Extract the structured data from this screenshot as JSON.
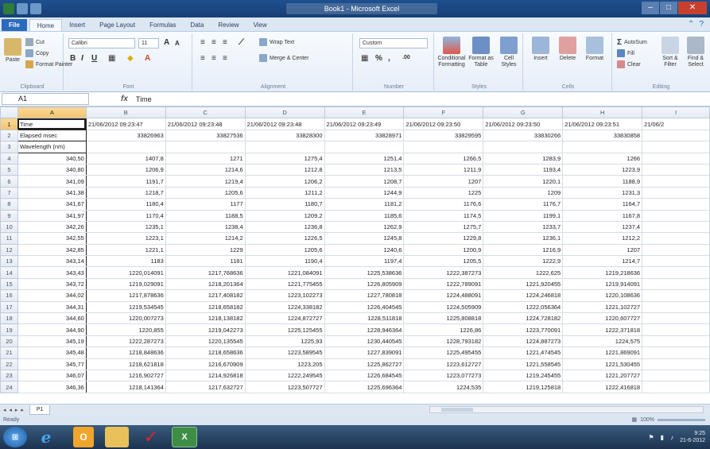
{
  "window": {
    "title": "Book1 - Microsoft Excel"
  },
  "ribbon_tabs": [
    "File",
    "Home",
    "Insert",
    "Page Layout",
    "Formulas",
    "Data",
    "Review",
    "View"
  ],
  "ribbon": {
    "clipboard": {
      "paste": "Paste",
      "cut": "Cut",
      "copy": "Copy",
      "format_painter": "Format Painter",
      "label": "Clipboard"
    },
    "font": {
      "name": "Calibri",
      "size": "11",
      "label": "Font"
    },
    "alignment": {
      "wrap": "Wrap Text",
      "merge": "Merge & Center",
      "label": "Alignment"
    },
    "number": {
      "format": "Custom",
      "label": "Number"
    },
    "styles": {
      "conditional": "Conditional Formatting",
      "format_table": "Format as Table",
      "cell_styles": "Cell Styles",
      "label": "Styles"
    },
    "cells": {
      "insert": "Insert",
      "delete": "Delete",
      "format": "Format",
      "label": "Cells"
    },
    "editing": {
      "autosum": "AutoSum",
      "fill": "Fill",
      "clear": "Clear",
      "sort": "Sort & Filter",
      "find": "Find & Select",
      "label": "Editing"
    }
  },
  "formula_bar": {
    "name_box": "A1",
    "fx": "fx",
    "formula": "Time"
  },
  "columns": [
    "A",
    "B",
    "C",
    "D",
    "E",
    "F",
    "G",
    "H",
    "I"
  ],
  "rows": [
    [
      "Time",
      "21/06/2012 09:23:47",
      "21/06/2012 09:23:48",
      "21/06/2012 09:23:48",
      "21/06/2012 09:23:49",
      "21/06/2012 09:23:50",
      "21/06/2012 09:23:50",
      "21/06/2012 09:23:51",
      "21/06/2"
    ],
    [
      "Elapsed msec",
      "33826963",
      "33827536",
      "33828300",
      "33828971",
      "33829595",
      "33830266",
      "33830858",
      ""
    ],
    [
      "Wavelength (nm)",
      "",
      "",
      "",
      "",
      "",
      "",
      "",
      ""
    ],
    [
      "340,50",
      "1407,8",
      "1271",
      "1275,4",
      "1251,4",
      "1266,5",
      "1283,9",
      "1266",
      ""
    ],
    [
      "340,80",
      "1206,9",
      "1214,6",
      "1212,8",
      "1213,5",
      "1211,9",
      "1193,4",
      "1223,9",
      ""
    ],
    [
      "341,09",
      "1191,7",
      "1219,4",
      "1206,2",
      "1208,7",
      "1207",
      "1220,1",
      "1188,9",
      ""
    ],
    [
      "341,38",
      "1218,7",
      "1205,6",
      "1211,2",
      "1244,9",
      "1225",
      "1209",
      "1231,3",
      ""
    ],
    [
      "341,67",
      "1180,4",
      "1177",
      "1180,7",
      "1181,2",
      "1176,6",
      "1176,7",
      "1164,7",
      ""
    ],
    [
      "341,97",
      "1170,4",
      "1188,5",
      "1209,2",
      "1185,6",
      "1174,5",
      "1199,1",
      "1167,8",
      ""
    ],
    [
      "342,26",
      "1235,1",
      "1238,4",
      "1236,8",
      "1262,9",
      "1275,7",
      "1233,7",
      "1237,4",
      ""
    ],
    [
      "342,55",
      "1223,1",
      "1214,2",
      "1226,5",
      "1245,8",
      "1229,8",
      "1236,1",
      "1212,2",
      ""
    ],
    [
      "342,85",
      "1221,1",
      "1229",
      "1205,6",
      "1240,6",
      "1200,9",
      "1216,9",
      "1207",
      ""
    ],
    [
      "343,14",
      "1183",
      "1181",
      "1190,4",
      "1197,4",
      "1205,5",
      "1222,9",
      "1214,7",
      ""
    ],
    [
      "343,43",
      "1220,014091",
      "1217,768636",
      "1221,084091",
      "1225,538636",
      "1222,387273",
      "1222,625",
      "1219,218636",
      ""
    ],
    [
      "343,72",
      "1219,029091",
      "1218,201364",
      "1221,775455",
      "1226,805909",
      "1222,789091",
      "1221,920455",
      "1219,914091",
      ""
    ],
    [
      "344,02",
      "1217,878636",
      "1217,408182",
      "1223,102273",
      "1227,780818",
      "1224,488091",
      "1224,246818",
      "1220,108636",
      ""
    ],
    [
      "344,31",
      "1219,534545",
      "1218,658182",
      "1224,338182",
      "1226,404545",
      "1224,505909",
      "1222,056364",
      "1221,102727",
      ""
    ],
    [
      "344,60",
      "1220,007273",
      "1218,138182",
      "1224,872727",
      "1228,511818",
      "1225,808818",
      "1224,728182",
      "1220,607727",
      ""
    ],
    [
      "344,90",
      "1220,855",
      "1219,042273",
      "1225,125455",
      "1228,946364",
      "1226,86",
      "1223,770091",
      "1222,371818",
      ""
    ],
    [
      "345,19",
      "1222,287273",
      "1220,135545",
      "1225,93",
      "1230,440545",
      "1228,793182",
      "1224,887273",
      "1224,575",
      ""
    ],
    [
      "345,48",
      "1218,848636",
      "1218,658636",
      "1223,589545",
      "1227,839091",
      "1225,495455",
      "1221,474545",
      "1221,869091",
      ""
    ],
    [
      "345,77",
      "1218,621818",
      "1216,670909",
      "1223,205",
      "1225,862727",
      "1223,612727",
      "1221,558545",
      "1221,530455",
      ""
    ],
    [
      "346,07",
      "1216,902727",
      "1214,926818",
      "1222,249545",
      "1226,684545",
      "1223,077273",
      "1219,245455",
      "1221,207727",
      ""
    ],
    [
      "346,36",
      "1218,141364",
      "1217,632727",
      "1223,507727",
      "1225,696364",
      "1224,535",
      "1219,125818",
      "1222,416818",
      ""
    ]
  ],
  "sheet_tabs": {
    "nav": "◂ ◂ ▸ ▸",
    "active": "P1"
  },
  "status": {
    "ready": "Ready",
    "zoom": "100%"
  },
  "taskbar": {
    "clock_time": "9:25",
    "clock_date": "21-6-2012"
  }
}
